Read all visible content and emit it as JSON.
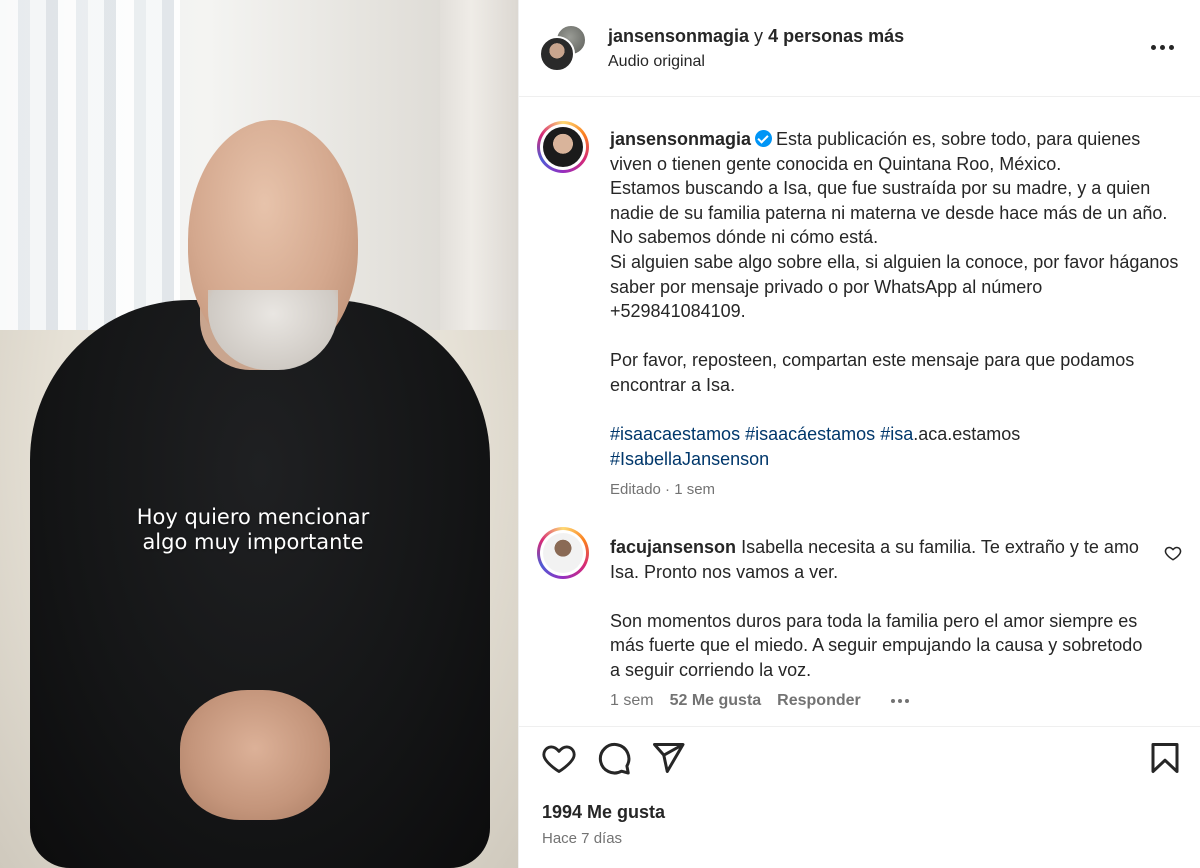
{
  "video": {
    "caption_line1": "Hoy quiero mencionar",
    "caption_line2": "algo muy importante"
  },
  "header": {
    "username": "jansensonmagia",
    "connector": " y ",
    "others": "4 personas más",
    "audio": "Audio original",
    "more_icon": "more-horizontal-icon"
  },
  "post": {
    "username": "jansensonmagia",
    "verified_icon": "verified-badge-icon",
    "text": "Esta publicación es, sobre todo, para quienes viven o tienen gente conocida en Quintana Roo, México.\nEstamos buscando a Isa, que fue sustraída por su madre, y a quien nadie de su familia paterna ni materna ve desde hace más de un año. No sabemos dónde ni cómo está.\nSi alguien sabe algo sobre ella, si alguien la conoce, por favor háganos saber por mensaje privado o por WhatsApp al número +529841084109.\n\nPor favor, reposteen, compartan este mensaje para que podamos encontrar a Isa.\n\n",
    "hashtags": [
      "#isaacaestamos",
      "#isaacáestamos",
      "#isa"
    ],
    "hashtag_suffix": ".aca.estamos",
    "hashtag_last": "#IsabellaJansenson",
    "meta": "Editado · 1 sem"
  },
  "comment": {
    "username": "facujansenson",
    "text": "Isabella necesita a su familia. Te extraño y te amo Isa. Pronto nos vamos a ver.\n\nSon momentos duros para toda la familia pero el amor siempre es más fuerte que el miedo. A seguir empujando la causa y sobretodo a seguir corriendo la voz.",
    "time": "1 sem",
    "likes": "52 Me gusta",
    "reply": "Responder"
  },
  "footer": {
    "likes": "1994 Me gusta",
    "ago": "Hace 7 días",
    "icons": [
      "heart-icon",
      "comment-icon",
      "share-icon",
      "bookmark-icon"
    ]
  },
  "colors": {
    "link": "#00376b",
    "muted": "#737373",
    "verified": "#0095f6",
    "text": "#262626"
  }
}
